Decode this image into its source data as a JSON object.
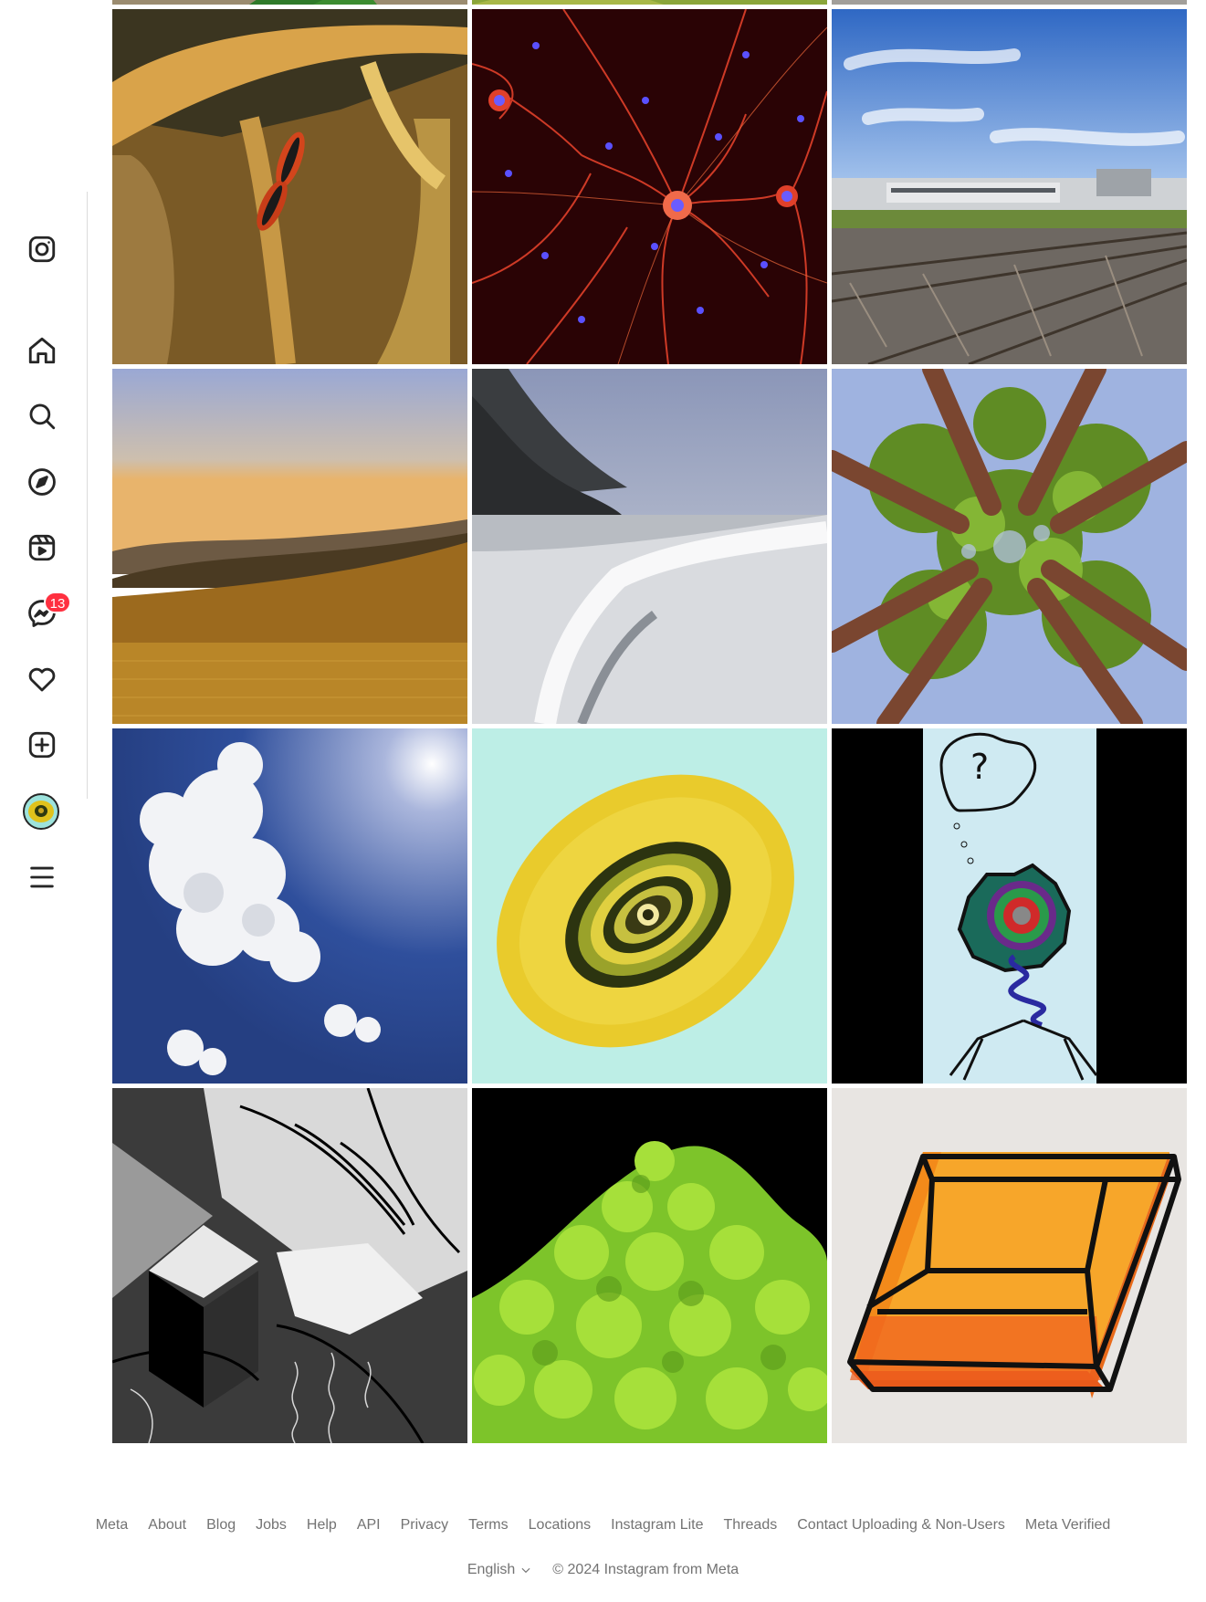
{
  "sidebar": {
    "items": [
      {
        "name": "instagram-logo-icon"
      },
      {
        "name": "home-icon"
      },
      {
        "name": "search-icon"
      },
      {
        "name": "explore-icon"
      },
      {
        "name": "reels-icon"
      },
      {
        "name": "messenger-icon"
      },
      {
        "name": "heart-icon"
      },
      {
        "name": "create-icon"
      },
      {
        "name": "profile-avatar"
      },
      {
        "name": "menu-icon"
      }
    ],
    "messages_badge": "13",
    "badge_color": "#ff3040"
  },
  "grid": {
    "photos": [
      {
        "subject": "plant"
      },
      {
        "subject": "leaves"
      },
      {
        "subject": "gravel"
      },
      {
        "subject": "boxelder bugs on bark"
      },
      {
        "subject": "neurons fluorescence"
      },
      {
        "subject": "train on tracks"
      },
      {
        "subject": "golden hills sunset"
      },
      {
        "subject": "foamy beach cliffs"
      },
      {
        "subject": "redwood canopy"
      },
      {
        "subject": "clouds and sun"
      },
      {
        "subject": "yellow spiral"
      },
      {
        "subject": "question mark drawing"
      },
      {
        "subject": "black and white drawing"
      },
      {
        "subject": "romanesco broccoli"
      },
      {
        "subject": "orange cube drawing"
      }
    ]
  },
  "footer": {
    "links": [
      "Meta",
      "About",
      "Blog",
      "Jobs",
      "Help",
      "API",
      "Privacy",
      "Terms",
      "Locations",
      "Instagram Lite",
      "Threads",
      "Contact Uploading & Non-Users",
      "Meta Verified"
    ],
    "language": "English",
    "copyright": "© 2024 Instagram from Meta"
  }
}
